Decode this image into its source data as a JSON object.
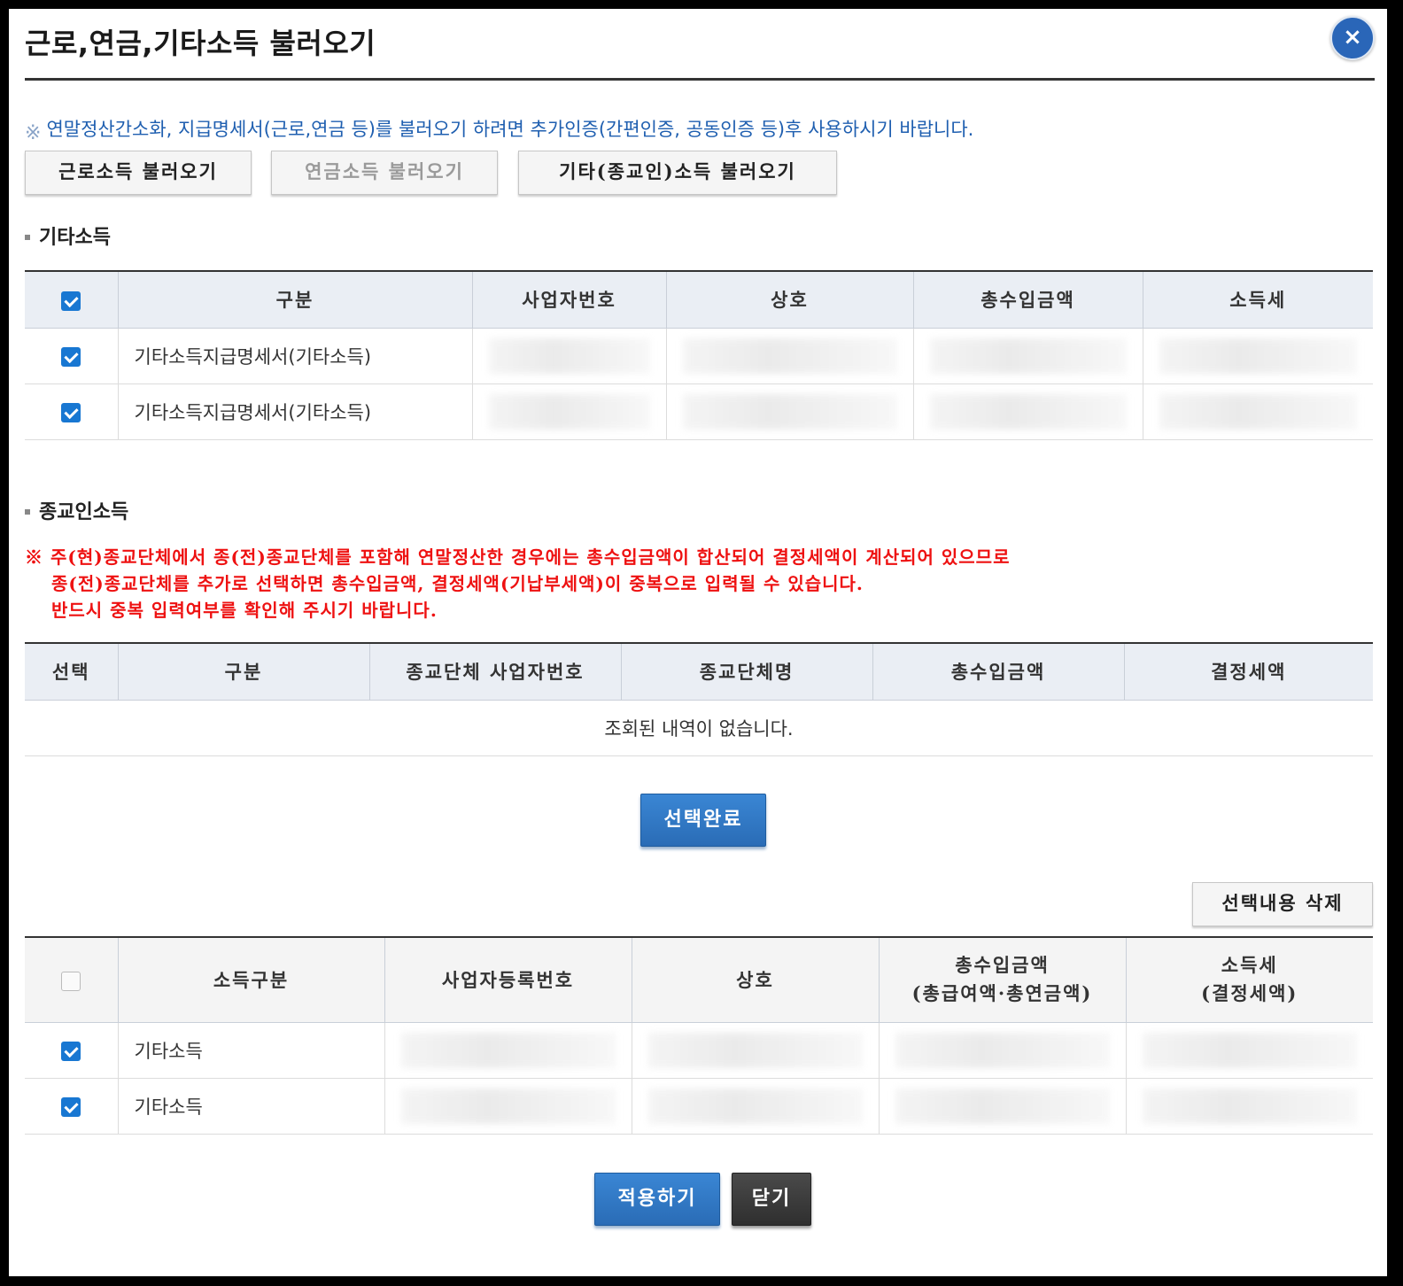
{
  "dialog": {
    "title": "근로,연금,기타소득 불러오기",
    "close_icon": "×"
  },
  "notice": {
    "mark": "※",
    "text": "연말정산간소화, 지급명세서(근로,연금 등)를 불러오기 하려면 추가인증(간편인증, 공동인증 등)후 사용하시기 바랍니다."
  },
  "load_buttons": {
    "earned": "근로소득 불러오기",
    "pension": "연금소득 불러오기",
    "other": "기타(종교인)소득 불러오기"
  },
  "other_income": {
    "section_title": "기타소득",
    "columns": [
      "구분",
      "사업자번호",
      "상호",
      "총수입금액",
      "소득세"
    ],
    "header_checked": true,
    "rows": [
      {
        "checked": true,
        "type": "기타소득지급명세서(기타소득)"
      },
      {
        "checked": true,
        "type": "기타소득지급명세서(기타소득)"
      }
    ]
  },
  "religious_income": {
    "section_title": "종교인소득",
    "warning_mark": "※",
    "warning_lines": [
      "주(현)종교단체에서 종(전)종교단체를 포함해 연말정산한 경우에는 총수입금액이 합산되어 결정세액이 계산되어 있으므로",
      "종(전)종교단체를 추가로 선택하면 총수입금액, 결정세액(기납부세액)이 중복으로 입력될 수 있습니다.",
      "반드시 중복 입력여부를 확인해 주시기 바랍니다."
    ],
    "columns": [
      "선택",
      "구분",
      "종교단체 사업자번호",
      "종교단체명",
      "총수입금액",
      "결정세액"
    ],
    "empty_message": "조회된 내역이 없습니다."
  },
  "select_done_button": "선택완료",
  "delete_selected_button": "선택내용 삭제",
  "selected": {
    "header_checked": false,
    "columns": {
      "income_type": "소득구분",
      "biz_reg_no": "사업자등록번호",
      "company": "상호",
      "total_income_1": "총수입금액",
      "total_income_2": "(총급여액·총연금액)",
      "tax_1": "소득세",
      "tax_2": "(결정세액)"
    },
    "rows": [
      {
        "checked": true,
        "type": "기타소득"
      },
      {
        "checked": true,
        "type": "기타소득"
      }
    ]
  },
  "footer": {
    "apply": "적용하기",
    "close": "닫기"
  },
  "colors": {
    "accent_blue": "#2a6cb6",
    "notice_blue": "#1f5fb0",
    "warning_red": "#ee1111",
    "checkbox_blue": "#1877d2"
  }
}
